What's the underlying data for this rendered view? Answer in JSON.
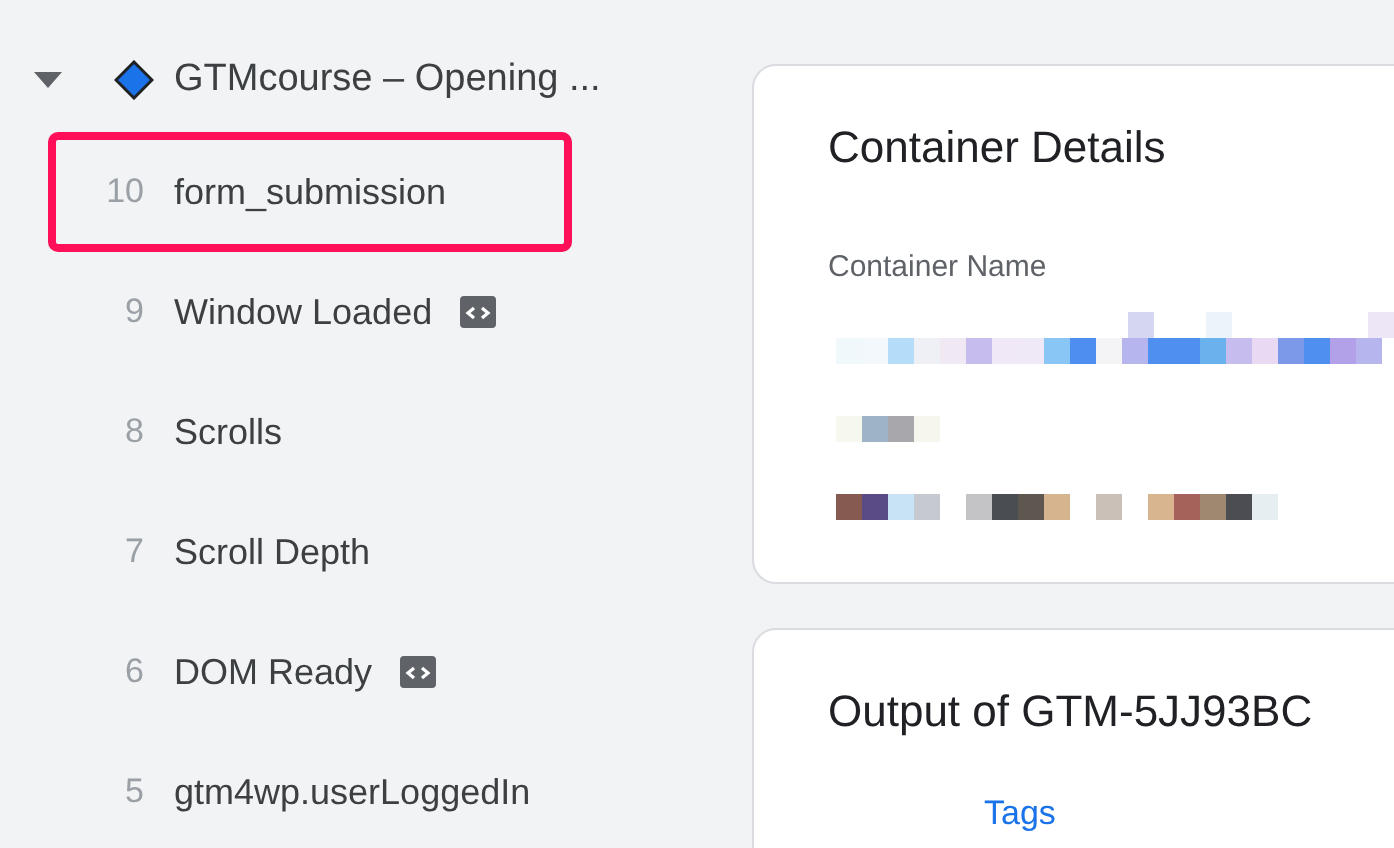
{
  "tree": {
    "title": "GTMcourse – Opening ...",
    "expanded": true,
    "events": [
      {
        "number": "10",
        "label": "form_submission",
        "highlighted": true,
        "badge": false
      },
      {
        "number": "9",
        "label": "Window Loaded",
        "highlighted": false,
        "badge": true
      },
      {
        "number": "8",
        "label": "Scrolls",
        "highlighted": false,
        "badge": false
      },
      {
        "number": "7",
        "label": "Scroll Depth",
        "highlighted": false,
        "badge": false
      },
      {
        "number": "6",
        "label": "DOM Ready",
        "highlighted": false,
        "badge": true
      },
      {
        "number": "5",
        "label": "gtm4wp.userLoggedIn",
        "highlighted": false,
        "badge": false
      }
    ]
  },
  "container_details": {
    "title": "Container Details",
    "field_label": "Container Name"
  },
  "output": {
    "title": "Output of GTM-5JJ93BC",
    "tabs": [
      {
        "label": "Tags",
        "selected": true
      }
    ]
  }
}
